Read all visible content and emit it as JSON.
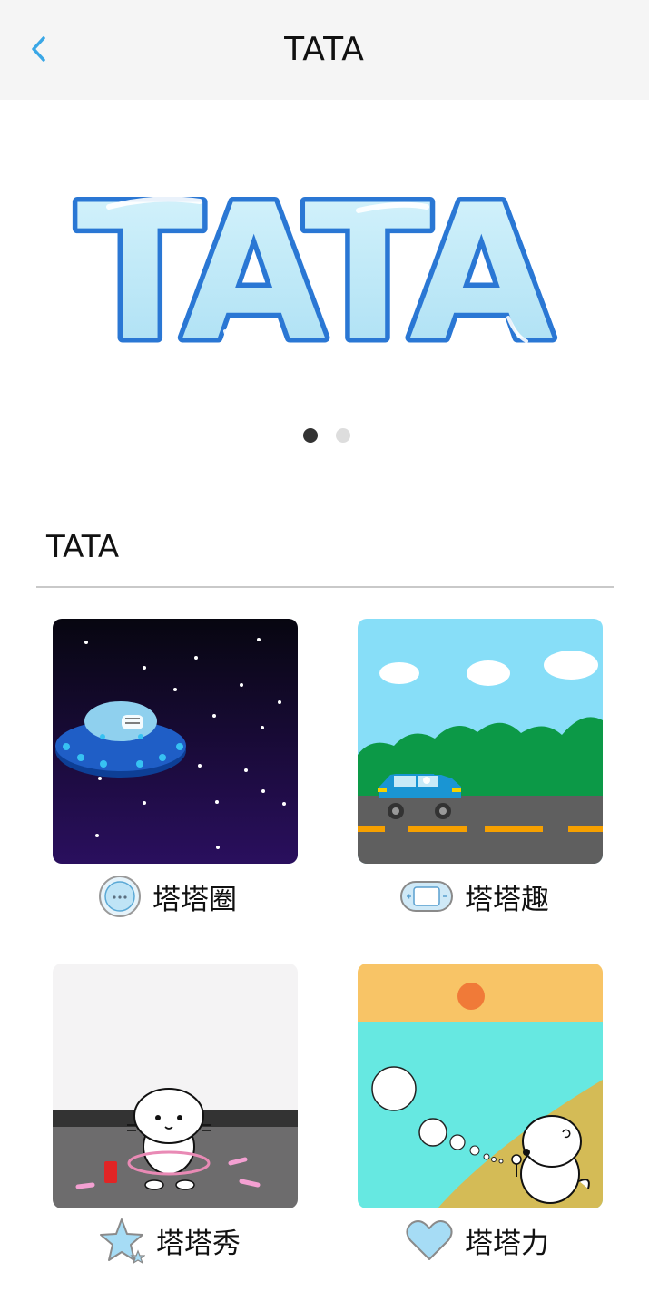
{
  "header": {
    "title": "TATA",
    "back_icon": "chevron-left-icon",
    "accent": "#3aa7e6"
  },
  "banner": {
    "logo_text": "TATA",
    "slides": 2,
    "active_slide": 1
  },
  "section": {
    "title": "TATA"
  },
  "grid": [
    {
      "label": "塔塔圈",
      "icon": "chat-bubble-icon",
      "scene": "ufo-space"
    },
    {
      "label": "塔塔趣",
      "icon": "game-console-icon",
      "scene": "car-road"
    },
    {
      "label": "塔塔秀",
      "icon": "star-icon",
      "scene": "otter-hula-hoop"
    },
    {
      "label": "塔塔力",
      "icon": "heart-icon",
      "scene": "otter-bubbles-beach"
    }
  ],
  "colors": {
    "header_bg": "#f5f5f5",
    "logo_fill": "#b7e6f6",
    "logo_outline": "#2a77d4",
    "dot_active": "#333333",
    "dot_inactive": "#dddddd"
  }
}
